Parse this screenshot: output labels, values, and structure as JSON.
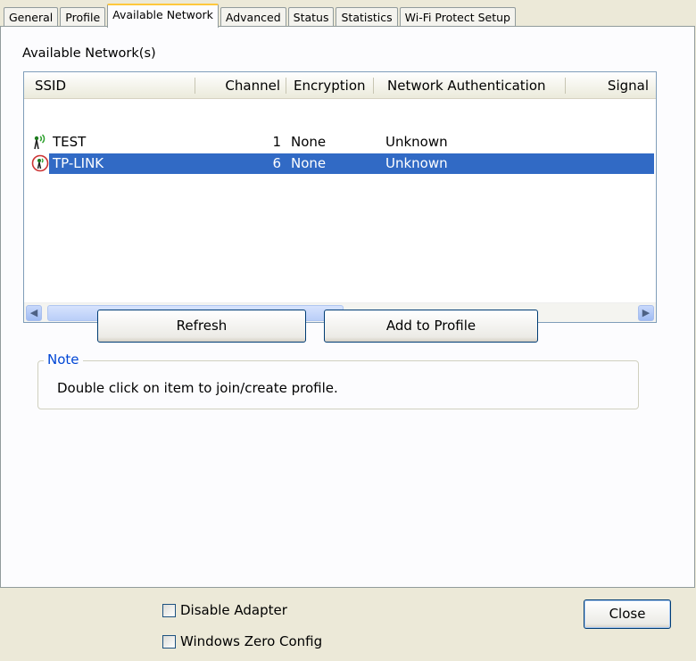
{
  "tabs": [
    {
      "label": "General"
    },
    {
      "label": "Profile"
    },
    {
      "label": "Available Network"
    },
    {
      "label": "Advanced"
    },
    {
      "label": "Status"
    },
    {
      "label": "Statistics"
    },
    {
      "label": "Wi-Fi Protect Setup"
    }
  ],
  "active_tab": "Available Network",
  "group_title": "Available Network(s)",
  "columns": {
    "ssid": "SSID",
    "channel": "Channel",
    "encryption": "Encryption",
    "auth": "Network Authentication",
    "signal": "Signal"
  },
  "networks": [
    {
      "ssid": "TEST",
      "channel": "1",
      "encryption": "None",
      "auth": "Unknown",
      "icon": "wifi-signal-icon",
      "selected": false
    },
    {
      "ssid": "TP-LINK",
      "channel": "6",
      "encryption": "None",
      "auth": "Unknown",
      "icon": "wifi-connected-icon",
      "selected": true
    }
  ],
  "buttons": {
    "refresh": "Refresh",
    "add_to_profile": "Add to Profile",
    "close": "Close"
  },
  "note": {
    "title": "Note",
    "text": "Double click on item to join/create profile."
  },
  "checkboxes": {
    "disable_adapter": "Disable Adapter",
    "windows_zero_config": "Windows Zero Config"
  },
  "colors": {
    "selection": "#316AC5",
    "note_title": "#0046D5",
    "dialog_bg": "#ECE9D8"
  }
}
